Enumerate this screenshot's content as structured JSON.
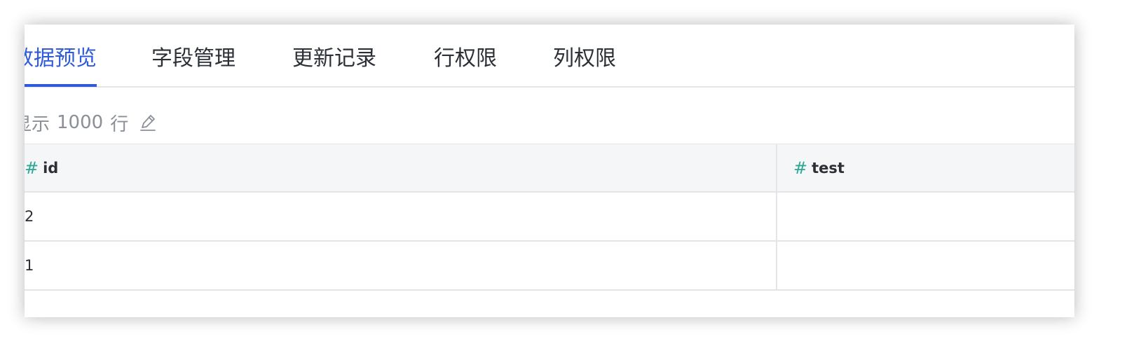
{
  "tabs": [
    {
      "label": "数据预览",
      "active": true
    },
    {
      "label": "字段管理",
      "active": false
    },
    {
      "label": "更新记录",
      "active": false
    },
    {
      "label": "行权限",
      "active": false
    },
    {
      "label": "列权限",
      "active": false
    }
  ],
  "row_count": {
    "prefix": "显示",
    "value": "1000",
    "suffix": "行",
    "icon": "edit-icon"
  },
  "table": {
    "columns": [
      {
        "type_icon": "#",
        "label": "id"
      },
      {
        "type_icon": "#",
        "label": "test"
      }
    ],
    "rows": [
      [
        "2",
        ""
      ],
      [
        "1",
        ""
      ]
    ]
  },
  "colors": {
    "accent": "#2f5bdb",
    "type_icon": "#2aa894",
    "header_bg": "#f5f6f7",
    "border": "#e3e5e8"
  }
}
